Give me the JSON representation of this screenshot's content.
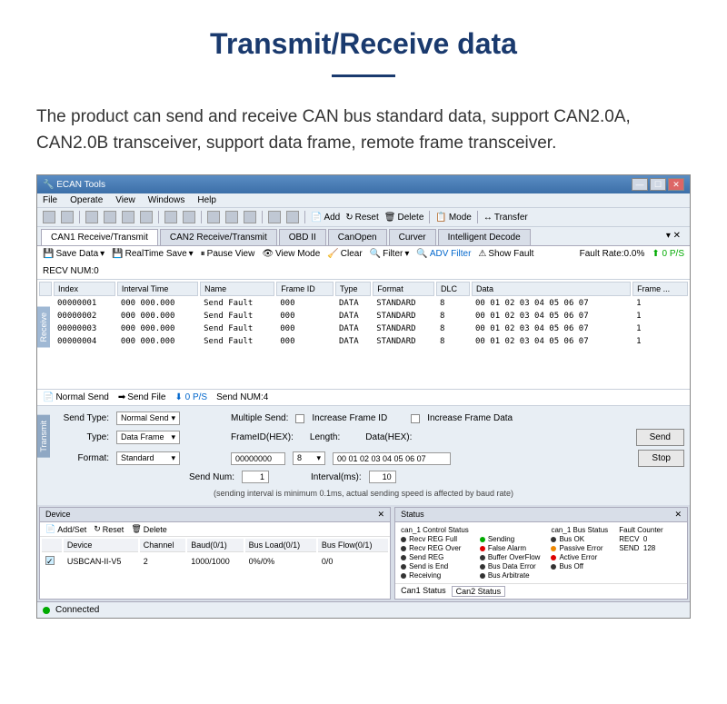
{
  "page": {
    "title": "Transmit/Receive data",
    "description": "The product can send and receive CAN bus standard data, support CAN2.0A, CAN2.0B transceiver, support data frame, remote frame transceiver."
  },
  "window": {
    "title": "ECAN Tools",
    "menu": [
      "File",
      "Operate",
      "View",
      "Windows",
      "Help"
    ],
    "toolbar": {
      "add": "Add",
      "reset": "Reset",
      "delete": "Delete",
      "mode": "Mode",
      "transfer": "Transfer"
    },
    "tabs": [
      "CAN1 Receive/Transmit",
      "CAN2 Receive/Transmit",
      "OBD II",
      "CanOpen",
      "Curver",
      "Intelligent Decode"
    ],
    "subbar": {
      "save": "Save Data",
      "realtime": "RealTime Save",
      "pause": "Pause View",
      "viewmode": "View Mode",
      "clear": "Clear",
      "filter": "Filter",
      "advfilter": "ADV Filter",
      "showfault": "Show Fault",
      "faultrate": "Fault Rate:0.0%",
      "ps": "0 P/S",
      "recvnum": "RECV NUM:0"
    },
    "table": {
      "headers": [
        "Index",
        "Interval Time",
        "Name",
        "Frame ID",
        "Type",
        "Format",
        "DLC",
        "Data",
        "Frame ..."
      ],
      "rows": [
        [
          "00000001",
          "000 000.000",
          "Send Fault",
          "000",
          "DATA",
          "STANDARD",
          "8",
          "00 01 02 03 04 05 06 07",
          "1"
        ],
        [
          "00000002",
          "000 000.000",
          "Send Fault",
          "000",
          "DATA",
          "STANDARD",
          "8",
          "00 01 02 03 04 05 06 07",
          "1"
        ],
        [
          "00000003",
          "000 000.000",
          "Send Fault",
          "000",
          "DATA",
          "STANDARD",
          "8",
          "00 01 02 03 04 05 06 07",
          "1"
        ],
        [
          "00000004",
          "000 000.000",
          "Send Fault",
          "000",
          "DATA",
          "STANDARD",
          "8",
          "00 01 02 03 04 05 06 07",
          "1"
        ]
      ],
      "side_rx": "Receive",
      "side_tx": "Transmit"
    },
    "sendbar": {
      "normal": "Normal Send",
      "sendfile": "Send File",
      "ps": "0 P/S",
      "sendnum": "Send NUM:4"
    },
    "tx": {
      "sendtype_lbl": "Send Type:",
      "sendtype_val": "Normal Send",
      "multiple": "Multiple Send:",
      "inc_id": "Increase Frame ID",
      "inc_data": "Increase Frame Data",
      "type_lbl": "Type:",
      "type_val": "Data Frame",
      "format_lbl": "Format:",
      "format_val": "Standard",
      "frameid_lbl": "FrameID(HEX):",
      "frameid_val": "00000000",
      "length_lbl": "Length:",
      "length_val": "8",
      "data_lbl": "Data(HEX):",
      "data_val": "00 01 02 03 04 05 06 07",
      "sendnum_lbl": "Send Num:",
      "sendnum_val": "1",
      "interval_lbl": "Interval(ms):",
      "interval_val": "10",
      "send_btn": "Send",
      "stop_btn": "Stop",
      "note": "(sending interval is minimum 0.1ms, actual sending speed is affected by baud rate)"
    },
    "device": {
      "hdr": "Device",
      "addset": "Add/Set",
      "reset": "Reset",
      "delete": "Delete",
      "headers": [
        "Device",
        "Channel",
        "Baud(0/1)",
        "Bus Load(0/1)",
        "Bus Flow(0/1)"
      ],
      "row": [
        "USBCAN-II-V5",
        "2",
        "1000/1000",
        "0%/0%",
        "0/0"
      ]
    },
    "status": {
      "hdr": "Status",
      "cols": {
        "ctrl_hdr": "can_1 Control Status",
        "ctrl": [
          "Recv REG Full",
          "Recv REG Over",
          "Send REG",
          "Send is End",
          "Receiving"
        ],
        "mid": [
          "Sending",
          "False Alarm",
          "Buffer OverFlow",
          "Bus Data Error",
          "Bus Arbitrate"
        ],
        "bus_hdr": "can_1 Bus Status",
        "bus": [
          "Bus OK",
          "Passive Error",
          "Active Error",
          "Bus Off"
        ],
        "fault_hdr": "Fault Counter",
        "recv_lbl": "RECV",
        "recv_val": "0",
        "send_lbl": "SEND",
        "send_val": "128"
      },
      "tabs": [
        "Can1 Status",
        "Can2 Status"
      ]
    },
    "statusbar": "Connected"
  }
}
